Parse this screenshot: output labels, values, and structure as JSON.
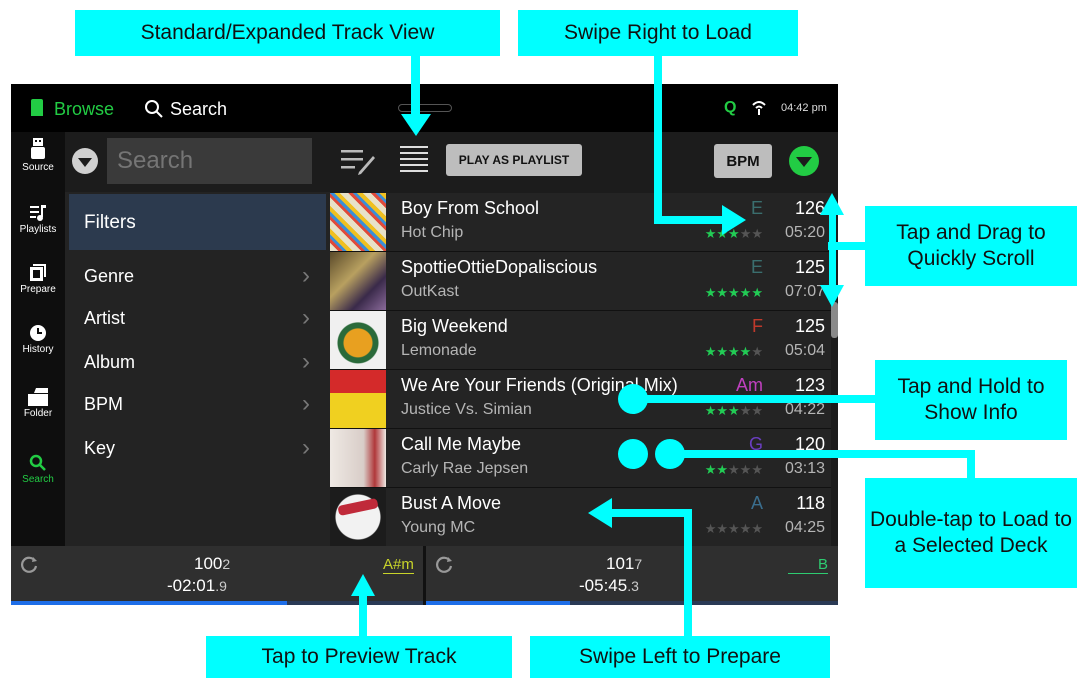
{
  "callouts": {
    "track_view": "Standard/Expanded Track View",
    "swipe_right": "Swipe Right to Load",
    "tap_drag": "Tap and Drag to Quickly Scroll",
    "tap_hold": "Tap and Hold to Show Info",
    "double_tap": "Double-tap to Load to a Selected Deck",
    "tap_preview": "Tap to Preview Track",
    "swipe_left": "Swipe Left to Prepare"
  },
  "statusbar": {
    "browse_label": "Browse",
    "search_label": "Search",
    "q_label": "Q",
    "time": "04:42 pm"
  },
  "sidenav": [
    {
      "label": "Source",
      "icon": "usb-icon"
    },
    {
      "label": "Playlists",
      "icon": "playlist-icon"
    },
    {
      "label": "Prepare",
      "icon": "prepare-icon"
    },
    {
      "label": "History",
      "icon": "clock-icon"
    },
    {
      "label": "Folder",
      "icon": "folder-icon"
    },
    {
      "label": "Search",
      "icon": "search-icon",
      "active": true
    }
  ],
  "search": {
    "placeholder": "Search"
  },
  "toolbar": {
    "play_as_playlist": "PLAY AS PLAYLIST",
    "sort_label": "BPM"
  },
  "filters": {
    "header": "Filters",
    "items": [
      "Genre",
      "Artist",
      "Album",
      "BPM",
      "Key"
    ]
  },
  "tracks": [
    {
      "title": "Boy From School",
      "artist": "Hot Chip",
      "key": "E",
      "key_color": "#3a6e6e",
      "bpm": "126",
      "time": "05:20",
      "stars": 3
    },
    {
      "title": "SpottieOttieDopaliscious",
      "artist": "OutKast",
      "key": "E",
      "key_color": "#3a6e6e",
      "bpm": "125",
      "time": "07:07",
      "stars": 5
    },
    {
      "title": "Big Weekend",
      "artist": "Lemonade",
      "key": "F",
      "key_color": "#c0392b",
      "bpm": "125",
      "time": "05:04",
      "stars": 4
    },
    {
      "title": "We Are Your Friends (Original Mix)",
      "artist": "Justice Vs. Simian",
      "key": "Am",
      "key_color": "#c040c0",
      "bpm": "123",
      "time": "04:22",
      "stars": 3
    },
    {
      "title": "Call Me Maybe",
      "artist": "Carly Rae Jepsen",
      "key": "G",
      "key_color": "#6a3ec0",
      "bpm": "120",
      "time": "03:13",
      "stars": 2
    },
    {
      "title": "Bust A Move",
      "artist": "Young MC",
      "key": "A",
      "key_color": "#3a6e8e",
      "bpm": "118",
      "time": "04:25",
      "stars": 0
    }
  ],
  "decks": [
    {
      "bpm_main": "100",
      "bpm_dec": "2",
      "time_main": "-02:01",
      "time_dec": ".9",
      "key": "A#m",
      "key_color": "#c8d42a"
    },
    {
      "bpm_main": "101",
      "bpm_dec": "7",
      "time_main": "-05:45",
      "time_dec": ".3",
      "key": "B",
      "key_color": "#2ecc71"
    }
  ],
  "colors": {
    "accent": "#00ffff",
    "green": "#22cc44",
    "star": "#22cc55"
  }
}
